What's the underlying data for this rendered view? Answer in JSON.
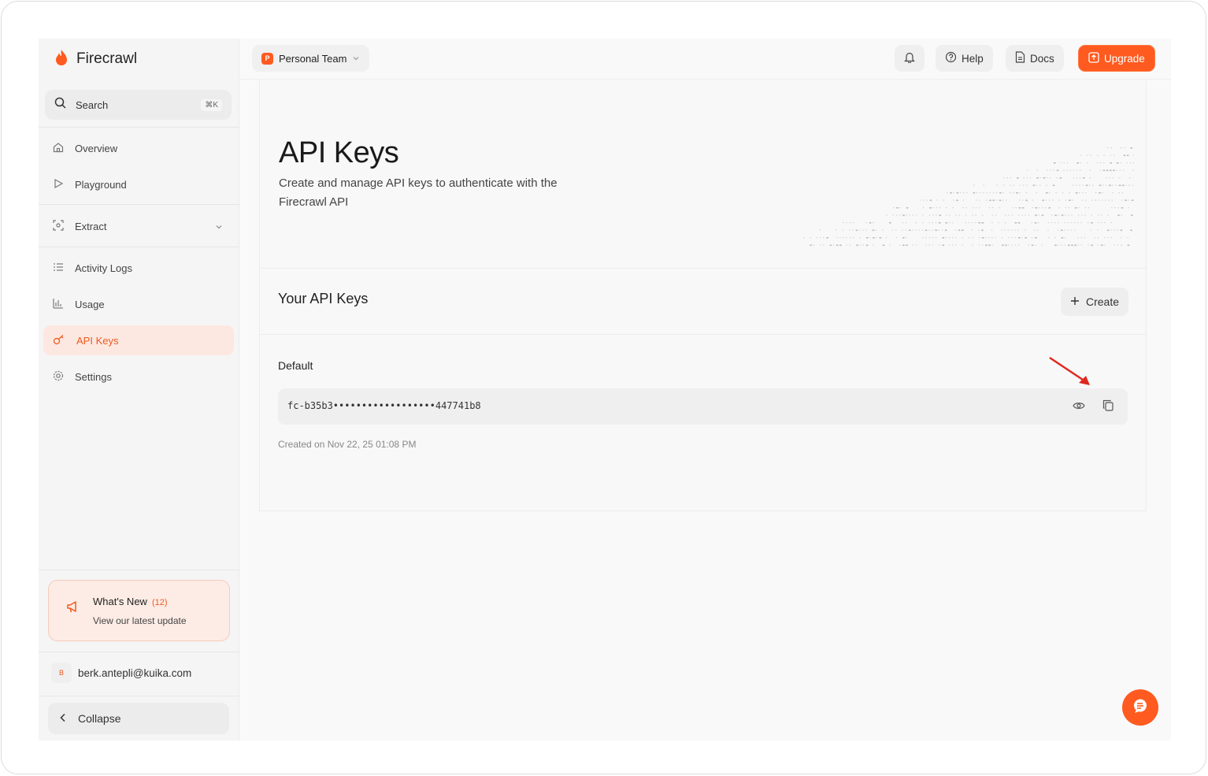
{
  "brand": {
    "name": "Firecrawl"
  },
  "search": {
    "label": "Search",
    "shortcut": "⌘K"
  },
  "nav": {
    "overview": "Overview",
    "playground": "Playground",
    "extract": "Extract",
    "activity_logs": "Activity Logs",
    "usage": "Usage",
    "api_keys": "API Keys",
    "settings": "Settings"
  },
  "whats_new": {
    "title": "What's New",
    "count": "(12)",
    "subtitle": "View our latest update"
  },
  "user": {
    "initial": "B",
    "email": "berk.antepli@kuika.com"
  },
  "collapse_label": "Collapse",
  "topbar": {
    "team_initial": "P",
    "team_name": "Personal Team",
    "help": "Help",
    "docs": "Docs",
    "upgrade": "Upgrade"
  },
  "page": {
    "title": "API Keys",
    "description": "Create and manage API keys to authenticate with the Firecrawl API"
  },
  "keys_section": {
    "title": "Your API Keys",
    "create_label": "Create"
  },
  "key": {
    "name": "Default",
    "masked_value": "fc-b35b3••••••••••••••••••447741b8",
    "created": "Created on Nov 22, 25 01:08 PM"
  },
  "colors": {
    "accent": "#ff5a1f",
    "active_bg": "#fde8e1",
    "annotation_arrow": "#e0281f"
  }
}
